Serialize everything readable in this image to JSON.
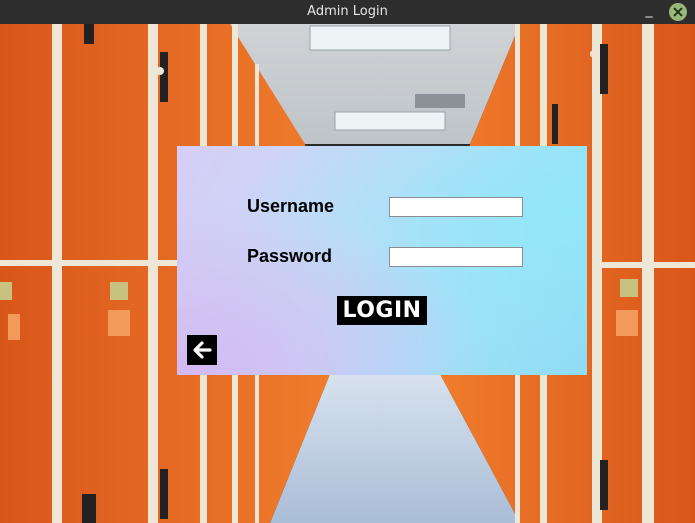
{
  "window": {
    "title": "Admin Login",
    "minimize_glyph": "_",
    "close_icon": "close-icon"
  },
  "login": {
    "username_label": "Username",
    "password_label": "Password",
    "username_value": "",
    "password_value": "",
    "login_button": "LOGIN",
    "back_icon": "arrow-left-icon"
  },
  "colors": {
    "titlebar": "#2d2d2d",
    "locker_orange": "#e96a22",
    "button_black": "#000000",
    "panel_cyan": "#93e6f8",
    "panel_lavender": "#d4b9f1"
  }
}
